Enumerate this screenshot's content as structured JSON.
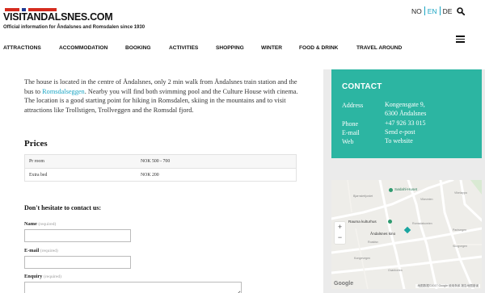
{
  "header": {
    "logo": "VISITANDALSNES.COM",
    "tagline": "Official information for Åndalsnes and Romsdalen since 1930",
    "languages": [
      "NO",
      "EN",
      "DE"
    ],
    "active_language": "EN",
    "search_icon": "search-icon",
    "menu_icon": "hamburger-icon"
  },
  "nav": [
    "ATTRACTIONS",
    "ACCOMMODATION",
    "BOOKING",
    "ACTIVITIES",
    "SHOPPING",
    "WINTER",
    "FOOD & DRINK",
    "TRAVEL AROUND"
  ],
  "intro": {
    "before_link": "The house is located in the centre of Åndalsnes, only 2 min walk from Åndalsnes train station and the bus to ",
    "link": "Romsdalseggen",
    "after_link": ". Nearby you will find both svimming pool and the Culture House with cinema. The location is a good starting point for hiking in Romsdalen, skiing in the mountains and to visit attractions like Trollstigen, Trollveggen and the Romsdal fjord."
  },
  "prices": {
    "title": "Prices",
    "rows": [
      {
        "label": "Pr room",
        "value": "NOK 500 - 700"
      },
      {
        "label": "Extra bed",
        "value": "NOK 200"
      }
    ]
  },
  "contact_form": {
    "title": "Don't hesitate to contact us:",
    "required_note": "(required)",
    "fields": [
      {
        "label": "Name",
        "value": ""
      },
      {
        "label": "E-mail",
        "value": ""
      },
      {
        "label": "Enquiry",
        "value": ""
      }
    ]
  },
  "sidebar": {
    "contact_title": "CONTACT",
    "address_label": "Address",
    "address_line1": "Kongensgate 9,",
    "address_line2": "6300 Åndalsnes",
    "phone_label": "Phone",
    "phone": "+47 926 33 015",
    "email_label": "E-mail",
    "email": "Send e-post",
    "web_label": "Web",
    "web": "To website",
    "accent_color": "#2cb5a2"
  },
  "map": {
    "places": [
      "Sødahl-Huset",
      "Rauma kulturhus",
      "Åndalsnes kino"
    ],
    "streets": [
      "Vikeveien",
      "Vikeløypa",
      "Bjørnslettjordet",
      "Romsdalsveien",
      "Roaldsv",
      "Kongevegen",
      "Grøntveien",
      "Parkvegen",
      "Skogvegen"
    ],
    "zoom_in": "+",
    "zoom_out": "−",
    "google": "Google",
    "credit": "地图数据©2017 Google   使用条款   报告地图错误"
  }
}
